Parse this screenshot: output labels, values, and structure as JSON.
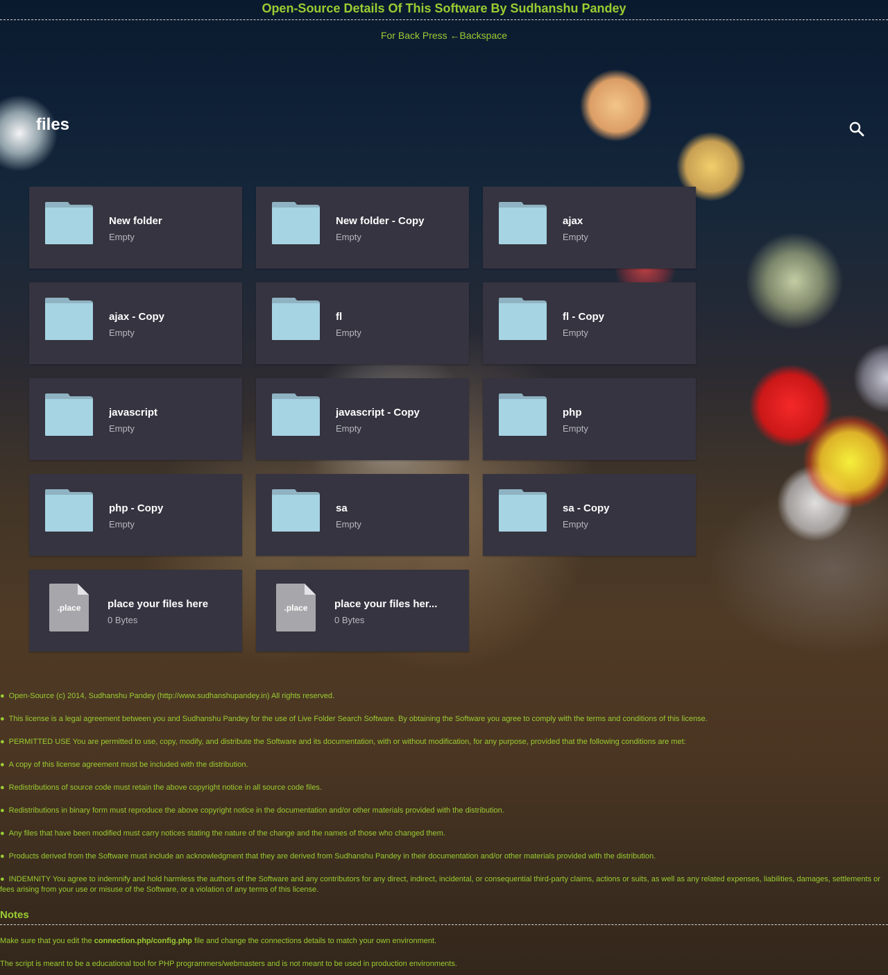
{
  "header": {
    "title": "Open-Source Details Of This Software By Sudhanshu Pandey",
    "back_hint": "For Back Press ←Backspace"
  },
  "section": {
    "title": "files",
    "search_icon": "search-icon"
  },
  "items": [
    {
      "name": "New folder",
      "meta": "Empty",
      "kind": "folder"
    },
    {
      "name": "New folder - Copy",
      "meta": "Empty",
      "kind": "folder"
    },
    {
      "name": "ajax",
      "meta": "Empty",
      "kind": "folder"
    },
    {
      "name": "ajax - Copy",
      "meta": "Empty",
      "kind": "folder"
    },
    {
      "name": "fl",
      "meta": "Empty",
      "kind": "folder"
    },
    {
      "name": "fl - Copy",
      "meta": "Empty",
      "kind": "folder"
    },
    {
      "name": "javascript",
      "meta": "Empty",
      "kind": "folder"
    },
    {
      "name": "javascript - Copy",
      "meta": "Empty",
      "kind": "folder"
    },
    {
      "name": "php",
      "meta": "Empty",
      "kind": "folder"
    },
    {
      "name": "php - Copy",
      "meta": "Empty",
      "kind": "folder"
    },
    {
      "name": "sa",
      "meta": "Empty",
      "kind": "folder"
    },
    {
      "name": "sa - Copy",
      "meta": "Empty",
      "kind": "folder"
    },
    {
      "name": "place your files here",
      "meta": "0 Bytes",
      "kind": "file",
      "ext": ".place"
    },
    {
      "name": "place your files her...",
      "meta": "0 Bytes",
      "kind": "file",
      "ext": ".place"
    }
  ],
  "license": [
    "Open-Source (c) 2014, Sudhanshu Pandey (http://www.sudhanshupandey.in) All rights reserved.",
    "This license is a legal agreement between you and Sudhanshu Pandey for the use of Live Folder Search Software. By obtaining the Software you agree to comply with the terms and conditions of this license.",
    "PERMITTED USE You are permitted to use, copy, modify, and distribute the Software and its documentation, with or without modification, for any purpose, provided that the following conditions are met:",
    "A copy of this license agreement must be included with the distribution.",
    "Redistributions of source code must retain the above copyright notice in all source code files.",
    "Redistributions in binary form must reproduce the above copyright notice in the documentation and/or other materials provided with the distribution.",
    "Any files that have been modified must carry notices stating the nature of the change and the names of those who changed them.",
    "Products derived from the Software must include an acknowledgment that they are derived from Sudhanshu Pandey in their documentation and/or other materials provided with the distribution.",
    "INDEMNITY You agree to indemnify and hold harmless the authors of the Software and any contributors for any direct, indirect, incidental, or consequential third-party claims, actions or suits, as well as any related expenses, liabilities, damages, settlements or fees arising from your use or misuse of the Software, or a violation of any terms of this license."
  ],
  "notes": {
    "title": "Notes",
    "line1_pre": "Make sure that you edit the ",
    "line1_bold": "connection.php/config.php",
    "line1_post": " file and change the connections details to match your own environment.",
    "line2": "The script is meant to be a educational tool for PHP programmers/webmasters and is not meant to be used in production environments."
  },
  "colors": {
    "accent": "#9acd32",
    "tile_bg": "#353440",
    "folder": "#a6d4e3",
    "folder_tab": "#8fb3c2",
    "file": "#a7a7ab"
  }
}
